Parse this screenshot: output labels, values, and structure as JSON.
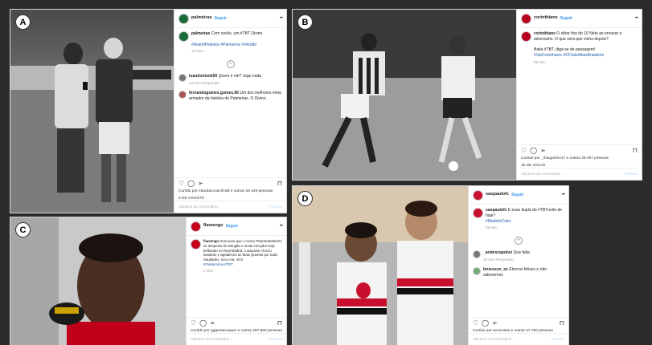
{
  "panels": {
    "a": {
      "label": "A",
      "account": "palmeiras",
      "follow": "Seguir",
      "caption_user": "palmeiras",
      "caption": "Com vocês, um #TBT Divino",
      "tags": "#AvantiPalestra #Palmeiras #Verdão",
      "time": "1d sem",
      "comments": [
        {
          "user": "luandonlook50",
          "text": "Quem é ele? Jogo nada",
          "meta": "1d sem  Responder"
        },
        {
          "user": "fernandogomes.gomes.56",
          "text": "Um dos melhores meia armador da história do Palmeiras. O Divino",
          "meta": ""
        }
      ],
      "liked": "Curtido por edudraconacifciall e outras 28.449 pessoas",
      "date": "6 DE AGOSTO",
      "add_comment": "Adicione um comentário...",
      "publish": "Publicar"
    },
    "b": {
      "label": "B",
      "account": "corinthians",
      "follow": "Seguir",
      "caption_user": "corinthians",
      "caption": "O olhar fixo do 10 Neto ao encarar o adversário. O que será que vinha depois?",
      "caption2": "Baita #TBT, diga-se de passagem!",
      "tags": "#VaiCorinthians #OClubeMaisBrasileiro",
      "time": "28 sem",
      "liked": "Curtido por _thiagainho17 e outras 28.497 pessoas",
      "date": "16 DE JULHO",
      "add_comment": "Adicione um comentário...",
      "publish": "Publicar"
    },
    "c": {
      "label": "C",
      "account": "flamengo",
      "follow": "Seguir",
      "caption_user": "flamengo",
      "caption": "Dois anos que o nosso #GarotoDoNinho se despediu do Mengão e muita emoção! Hoje brilhando no Real Madrid, o atacante chorou bastante e agradeceu ao Mais Querido por tudo!",
      "caption2": "Saudades, meu cria. Vini!",
      "tags": "#FlaMemória #TBT",
      "time": "2 sem",
      "liked": "Curtido por gggentenaquer e outras 267.850 pessoas",
      "date": "",
      "add_comment": "Adicione um comentário...",
      "publish": "Publicar"
    },
    "d": {
      "label": "D",
      "account": "saopaulofc",
      "follow": "Seguir",
      "caption_user": "saopaulofc",
      "caption": "E essa dupla do #TBTnoite de hoje?",
      "tags": "#MadeInCotia",
      "time": "25 sem",
      "comments": [
        {
          "user": "_andexcapolvo",
          "text": "Que falta",
          "meta": "25 sem  Responder"
        },
        {
          "user": "bruessun_se",
          "text": "Eternos felizes e não saberemos",
          "meta": ""
        }
      ],
      "liked": "Curtido por amorosas e outras 47.700 pessoas",
      "date": "",
      "add_comment": "Adicione um comentário...",
      "publish": "Publicar"
    }
  },
  "colors": {
    "palmeiras": "#1b6b3a",
    "corinthians": "#b8001f",
    "flamengo": "#c4001a",
    "saopaulo": "#c8102e",
    "link": "#1e5aa8"
  },
  "icons": [
    "heart-icon",
    "comment-icon",
    "share-icon",
    "bookmark-icon",
    "more-dots-icon",
    "plus-circle-icon"
  ]
}
